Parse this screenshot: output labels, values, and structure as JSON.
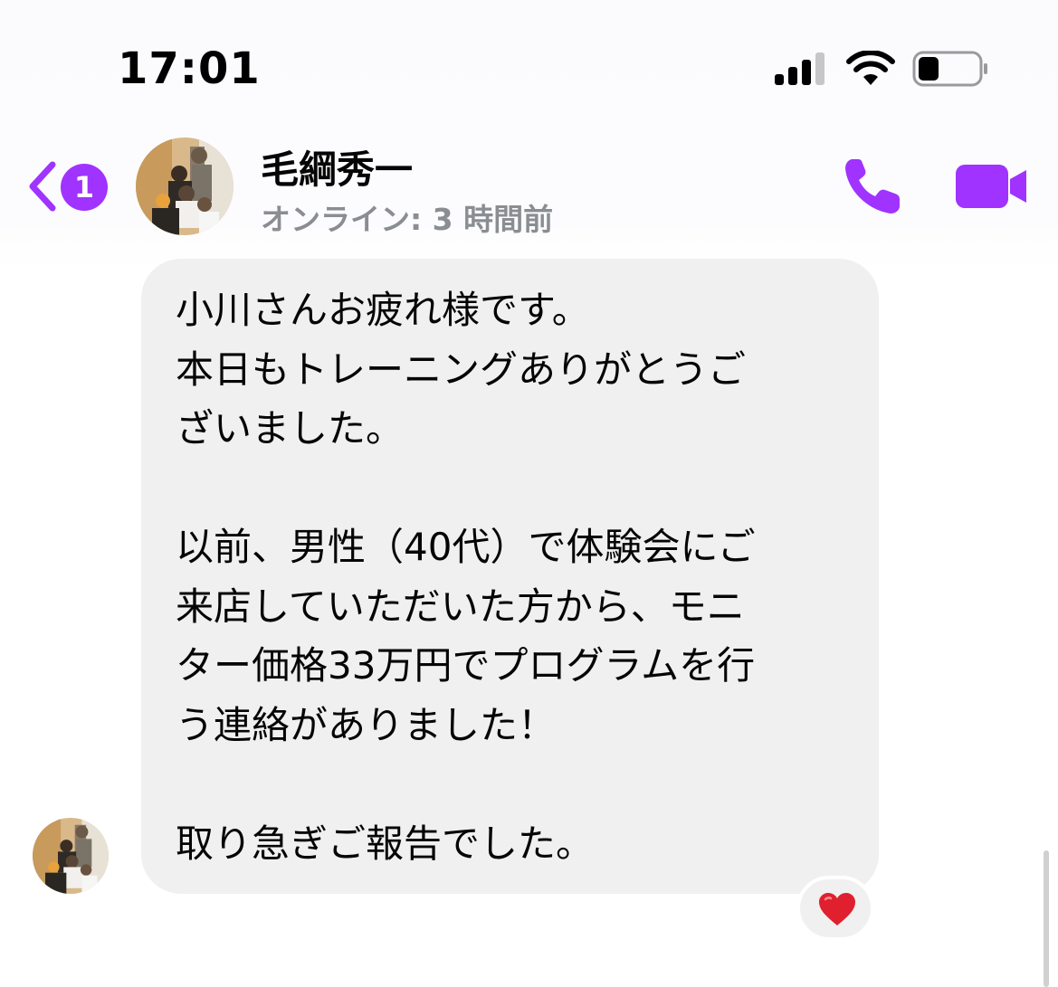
{
  "status_bar": {
    "time": "17:01",
    "signal_icon": "cellular-signal-icon",
    "wifi_icon": "wifi-icon",
    "battery_icon": "battery-icon",
    "battery_level": 0.35
  },
  "header": {
    "unread_count": "1",
    "contact_name": "毛綱秀一",
    "contact_status": "オンライン: 3 時間前",
    "call_icon": "phone-icon",
    "video_icon": "video-camera-icon",
    "accent_color": "#a033ff"
  },
  "message": {
    "text": "小川さんお疲れ様です。\n本日もトレーニングありがとうご\nざいました。\n\n以前、男性（40代）で体験会にご\n来店していただいた方から、モニ\nター価格33万円でプログラムを行\nう連絡がありました！\n\n取り急ぎご報告でした。",
    "bubble_color": "#f0f0f0",
    "reaction": "❤️"
  }
}
